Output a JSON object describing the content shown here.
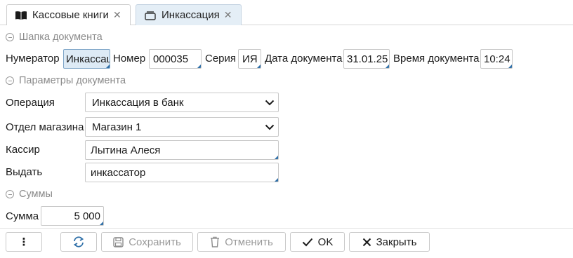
{
  "tabs": [
    {
      "label": "Кассовые книги",
      "icon": "book-icon",
      "active": false
    },
    {
      "label": "Инкассация",
      "icon": "document-stack-icon",
      "active": true
    }
  ],
  "header_group": {
    "title": "Шапка документа"
  },
  "header": {
    "numerator_label": "Нумератор",
    "numerator_value": "Инкассац",
    "number_label": "Номер",
    "number_value": "000035",
    "series_label": "Серия",
    "series_value": "ИЯ",
    "date_label": "Дата документа",
    "date_value": "31.01.25",
    "time_label": "Время документа",
    "time_value": "10:24"
  },
  "params_group": {
    "title": "Параметры документа"
  },
  "params": {
    "operation_label": "Операция",
    "operation_value": "Инкассация в банк",
    "department_label": "Отдел магазина",
    "department_value": "Магазин 1",
    "cashier_label": "Кассир",
    "cashier_value": "Лытина Алеся",
    "issue_label": "Выдать",
    "issue_value": "инкассатор"
  },
  "sums_group": {
    "title": "Суммы"
  },
  "sums": {
    "sum_label": "Сумма",
    "sum_value": "5 000"
  },
  "toolbar": {
    "more_label": "⋮",
    "save_label": "Сохранить",
    "cancel_label": "Отменить",
    "ok_label": "OK",
    "close_label": "Закрыть"
  },
  "colors": {
    "accent": "#2e6fa8",
    "active_tab": "#e4eef6",
    "focus_field": "#ddeaf5"
  }
}
